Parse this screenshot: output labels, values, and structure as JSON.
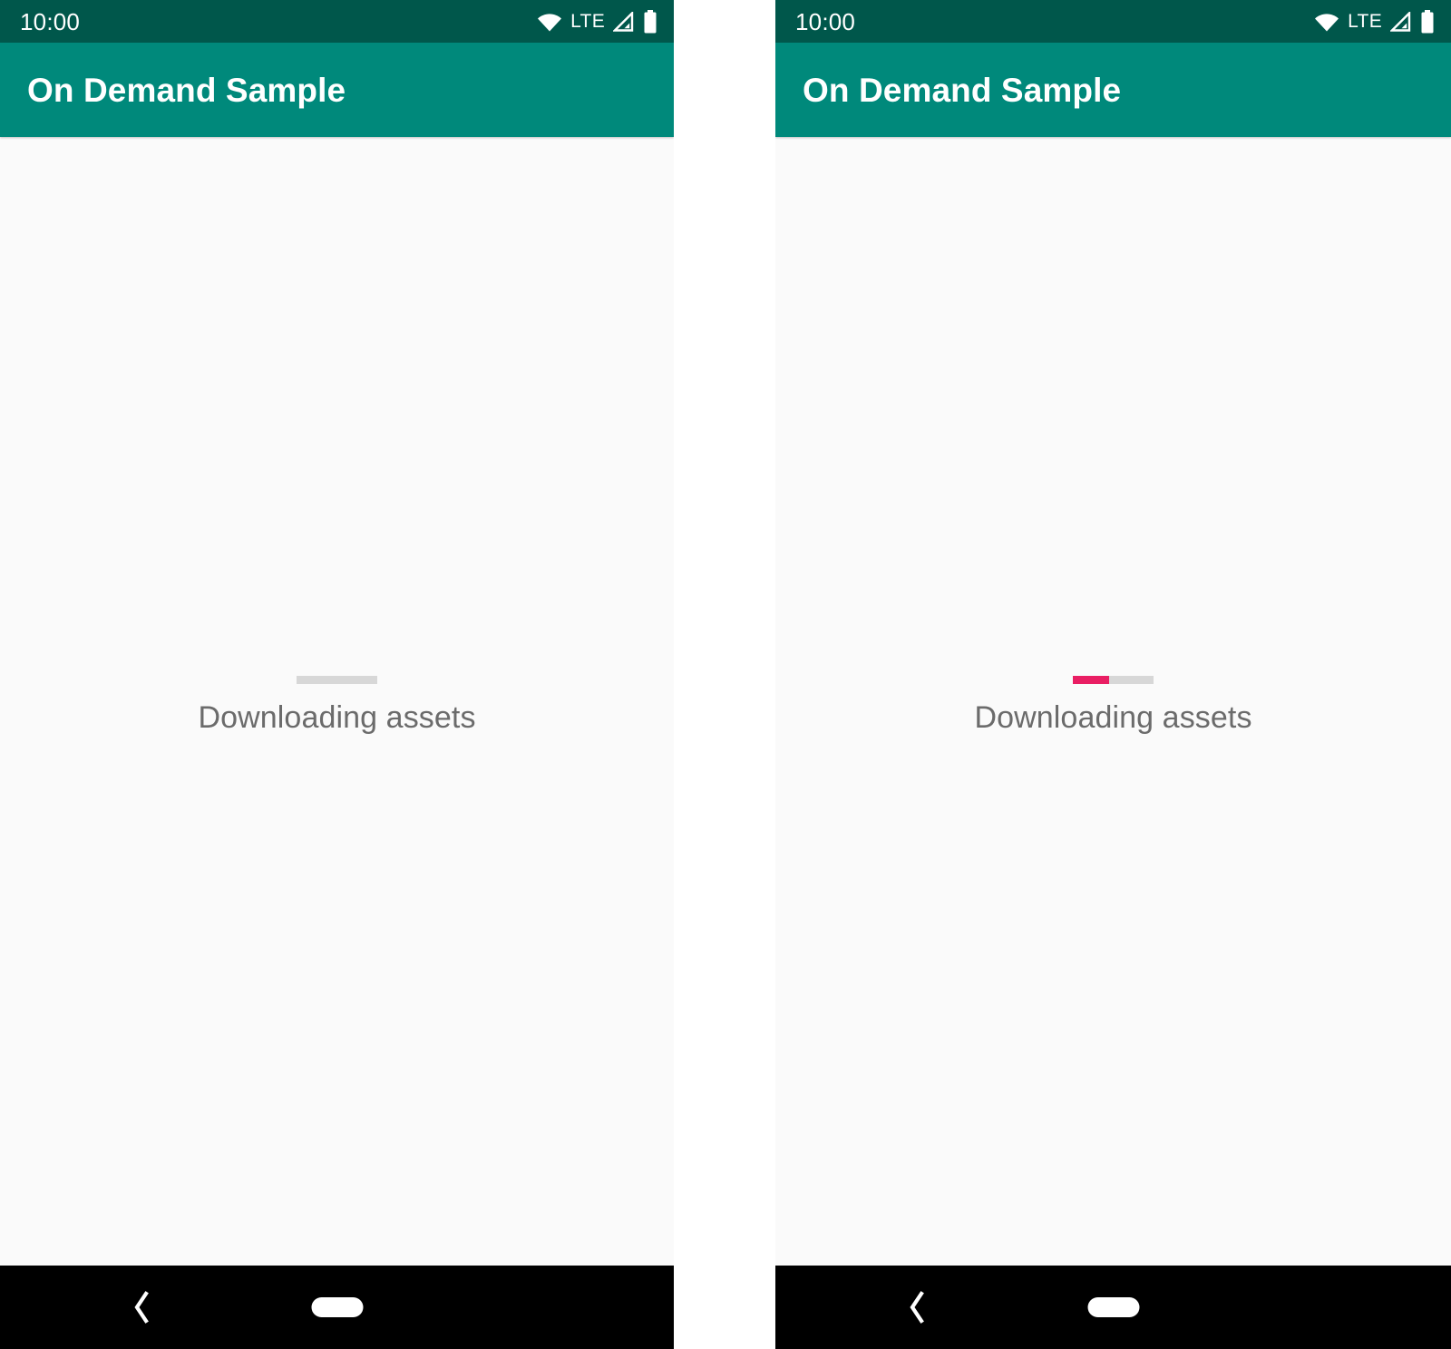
{
  "screenshot": {
    "panel_count": 2,
    "description": "Two side-by-side Android phone screenshots of the same app showing a download progress state"
  },
  "theme": {
    "status_bar_bg": "#00574B",
    "app_bar_bg": "#00897B",
    "content_bg": "#fafafa",
    "nav_bar_bg": "#000000",
    "progress_track": "#d7d7d7",
    "progress_accent": "#E91E63",
    "label_text": "#6b6b6b",
    "title_text": "#ffffff"
  },
  "panels": [
    {
      "id": "left",
      "status_bar": {
        "clock": "10:00",
        "network_label": "LTE",
        "icons": [
          "wifi-icon",
          "cellular-signal-icon",
          "battery-icon"
        ]
      },
      "app_bar": {
        "title": "On Demand Sample"
      },
      "content": {
        "progress": {
          "value": 0,
          "max": 100,
          "determinate": false
        },
        "label": "Downloading assets"
      },
      "nav_bar": {
        "back_label": "‹",
        "home_label": "home-pill"
      }
    },
    {
      "id": "right",
      "status_bar": {
        "clock": "10:00",
        "network_label": "LTE",
        "icons": [
          "wifi-icon",
          "cellular-signal-icon",
          "battery-icon"
        ]
      },
      "app_bar": {
        "title": "On Demand Sample"
      },
      "content": {
        "progress": {
          "value": 45,
          "max": 100,
          "determinate": true
        },
        "label": "Downloading assets"
      },
      "nav_bar": {
        "back_label": "‹",
        "home_label": "home-pill"
      }
    }
  ]
}
